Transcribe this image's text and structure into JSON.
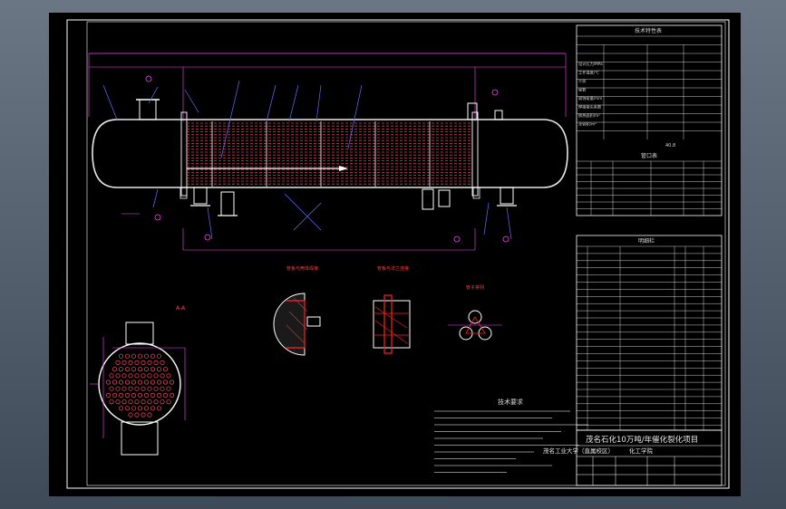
{
  "tech_table": {
    "title": "技术特性表",
    "row_labels": [
      "设计压力/MPa",
      "工作温度/℃",
      "介质",
      "程数",
      "腐蚀裕量/mm",
      "焊接接头系数",
      "换热面积/m²",
      "全容积/m³"
    ],
    "summary_value": "40.8"
  },
  "nozzle_table": {
    "title": "管口表"
  },
  "parts_table": {
    "title": "明细栏"
  },
  "title_block": {
    "project": "茂名石化10万吨/年催化裂化项目",
    "school": "茂名工业大学（直属校区）",
    "dept": "化工学院"
  },
  "notes": {
    "title": "技术要求"
  },
  "details": {
    "a": "管板与壳体焊接",
    "b": "管板与法兰连接",
    "c": "管子排列",
    "section": "A-A"
  },
  "colors": {
    "frame": "#ffffff",
    "vessel": "#e8e8e8",
    "tubes": "#e0405a",
    "leader": "#6a6aff",
    "dim": "#ff44ff",
    "detail_red": "#ff2020",
    "text": "#d8d8d8",
    "accent": "#ffff40"
  }
}
